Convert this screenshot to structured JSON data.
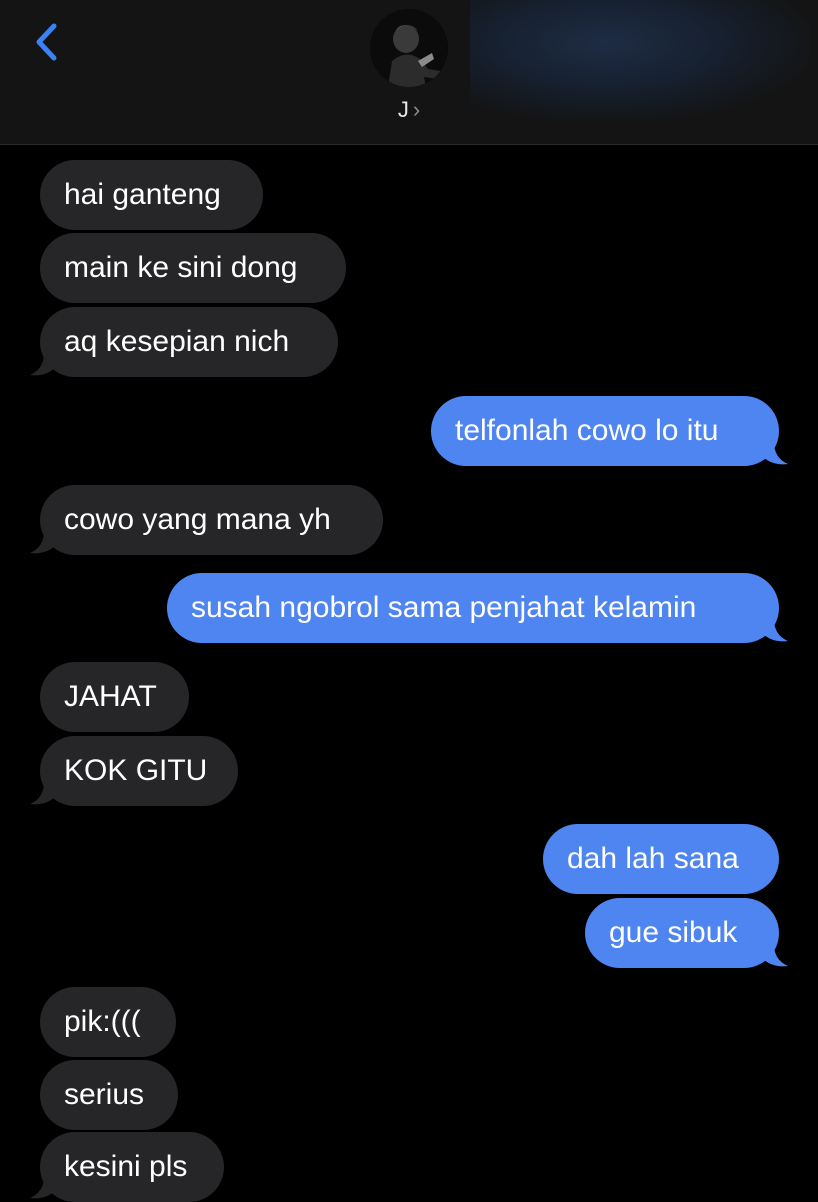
{
  "header": {
    "contact_name": "J",
    "chevron": "›",
    "back_icon": "chevron-left-icon",
    "avatar": "contact-avatar-photo"
  },
  "colors": {
    "incoming_bubble": "#262628",
    "outgoing_bubble": "#4f85f0",
    "accent": "#3b82f6",
    "background": "#000000"
  },
  "messages": [
    {
      "from": "them",
      "text": "hai ganteng"
    },
    {
      "from": "them",
      "text": "main ke sini dong"
    },
    {
      "from": "them",
      "text": "aq kesepian nich"
    },
    {
      "from": "me",
      "text": "telfonlah cowo lo itu"
    },
    {
      "from": "them",
      "text": "cowo yang mana yh"
    },
    {
      "from": "me",
      "text": "susah ngobrol sama penjahat kelamin"
    },
    {
      "from": "them",
      "text": "JAHAT"
    },
    {
      "from": "them",
      "text": "KOK GITU"
    },
    {
      "from": "me",
      "text": "dah lah sana"
    },
    {
      "from": "me",
      "text": "gue sibuk"
    },
    {
      "from": "them",
      "text": "pik:((("
    },
    {
      "from": "them",
      "text": "serius"
    },
    {
      "from": "them",
      "text": "kesini pls"
    }
  ]
}
